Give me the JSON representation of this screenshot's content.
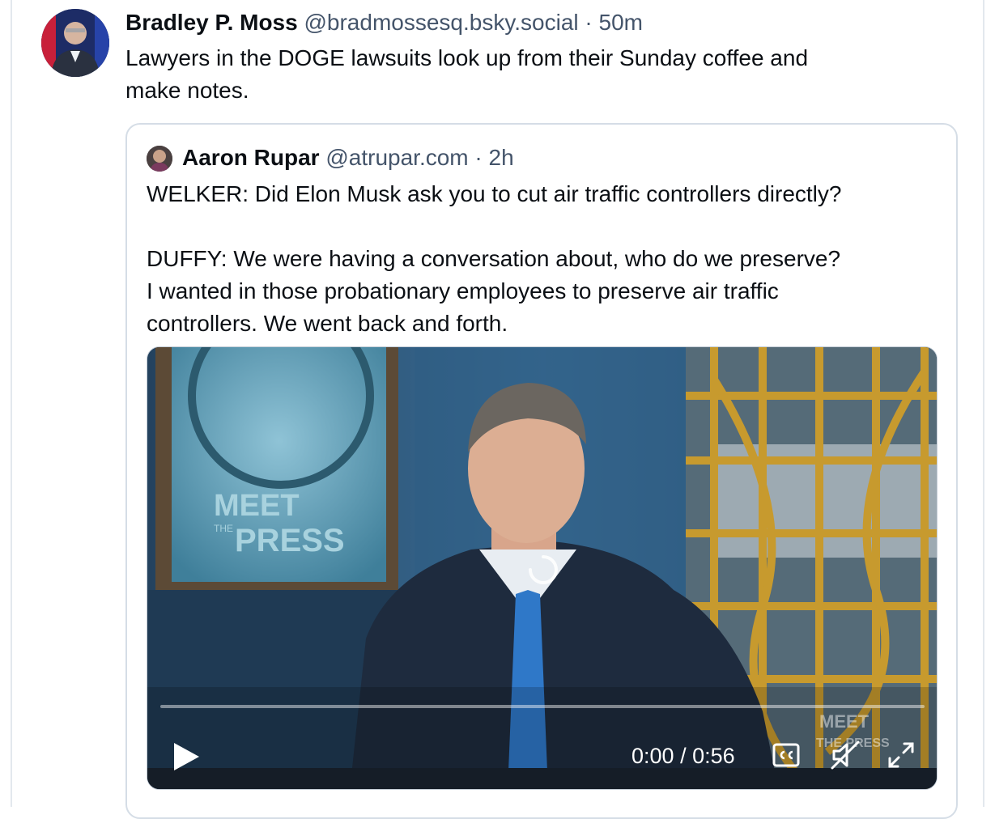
{
  "post": {
    "author_name": "Bradley P. Moss",
    "handle": "@bradmossesq.bsky.social",
    "separator": "·",
    "time": "50m",
    "text_line1": "Lawyers in the DOGE lawsuits look up from their Sunday coffee and",
    "text_line2": "make notes."
  },
  "quote": {
    "author_name": "Aaron Rupar",
    "handle": "@atrupar.com",
    "separator": "·",
    "time": "2h",
    "lines": [
      "WELKER: Did Elon Musk ask you to cut air traffic controllers directly?",
      "DUFFY: We were having a conversation about, who do we preserve?",
      "I wanted in those probationary employees to preserve air traffic",
      "controllers. We went back and forth."
    ]
  },
  "video": {
    "time_current": "0:00",
    "time_separator": " / ",
    "time_total": "0:56",
    "progress": 0,
    "overlay_logo_line1": "MEET",
    "overlay_logo_line2": "THE",
    "overlay_logo_line3": "PRESS",
    "watermark_line1": "MEET",
    "watermark_line2": "THE PRESS",
    "icons": [
      "play-icon",
      "closed-captions-icon",
      "muted-speaker-icon",
      "fullscreen-icon",
      "loading-spinner-icon"
    ]
  },
  "colors": {
    "text_primary": "#0b0f14",
    "text_secondary": "#44546a",
    "border": "#d5dde6"
  }
}
